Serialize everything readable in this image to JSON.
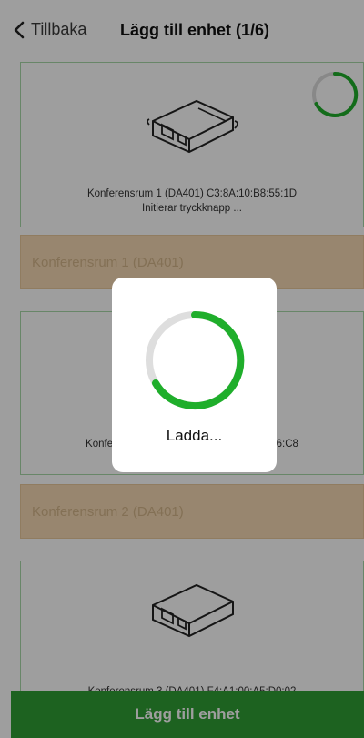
{
  "header": {
    "back_label": "Tillbaka",
    "title": "Lägg till enhet (1/6)"
  },
  "cards": [
    {
      "line1": "Konferensrum 1 (DA401) C3:8A:10:B8:55:1D",
      "line2": "Initierar tryckknapp ..."
    },
    {
      "line1": "Konfer                                                    :36:C8",
      "line2": ""
    },
    {
      "line1": "Konferensrum 3 (DA401) F4:A1:00:A5:D0:02",
      "line2": ""
    }
  ],
  "room_bars": [
    {
      "label": "Konferensrum 1 (DA401)"
    },
    {
      "label": "Konferensrum 2 (DA401)"
    }
  ],
  "bottom_button": {
    "label": "Lägg till enhet"
  },
  "modal": {
    "label": "Ladda..."
  },
  "colors": {
    "accent_green": "#2f9e35",
    "spinner_green": "#1fae2b",
    "room_bar_bg": "#f5d9b3"
  }
}
